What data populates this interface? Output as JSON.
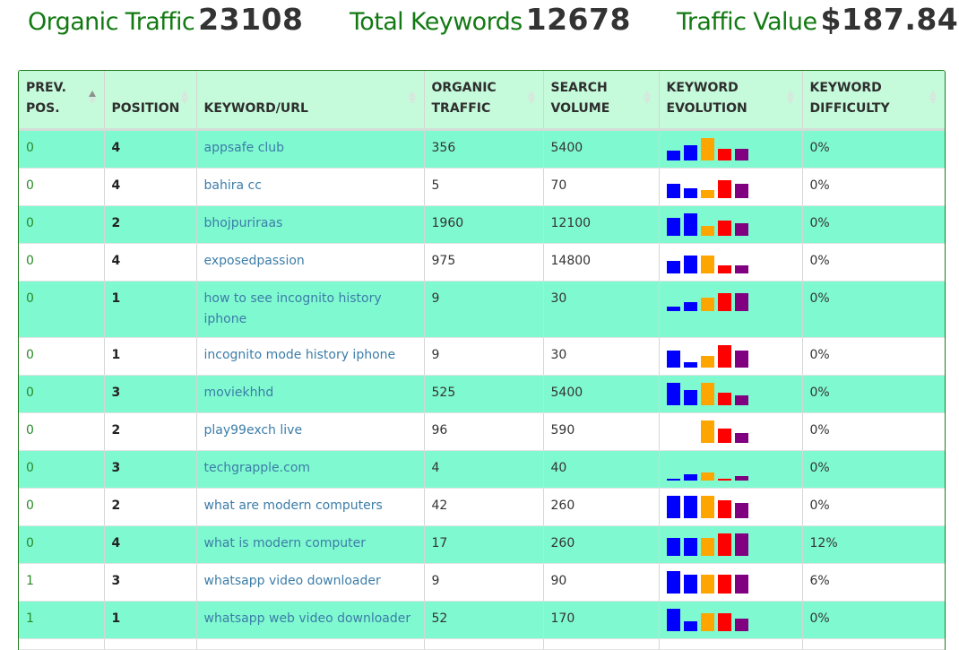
{
  "stats": {
    "organic_traffic": {
      "label": "Organic Traffic",
      "value": "23108"
    },
    "total_keywords": {
      "label": "Total Keywords",
      "value": "12678"
    },
    "traffic_value": {
      "label": "Traffic Value",
      "value": "$187.84"
    }
  },
  "colors": {
    "bar_colors": [
      "#0000ff",
      "#0000ff",
      "#ffa500",
      "#ff0000",
      "#800080"
    ],
    "stat_label": "#137a13",
    "header_bg": "#c5fadb",
    "odd_row_bg": "#7ff9d0"
  },
  "table": {
    "headers": [
      {
        "label": "PREV. POS.",
        "sort": "ascending"
      },
      {
        "label": "POSITION",
        "sort": "none"
      },
      {
        "label": "KEYWORD/URL",
        "sort": "none"
      },
      {
        "label": "ORGANIC TRAFFIC",
        "sort": "none"
      },
      {
        "label": "SEARCH VOLUME",
        "sort": "none"
      },
      {
        "label": "KEYWORD EVOLUTION",
        "sort": "none"
      },
      {
        "label": "KEYWORD DIFFICULTY",
        "sort": "none"
      }
    ],
    "rows": [
      {
        "prev": "0",
        "pos": "4",
        "keyword": "appsafe club",
        "traffic": "356",
        "volume": "5400",
        "evolution": [
          0.44,
          0.68,
          1.0,
          0.52,
          0.52
        ],
        "difficulty": "0%"
      },
      {
        "prev": "0",
        "pos": "4",
        "keyword": "bahira cc",
        "traffic": "5",
        "volume": "70",
        "evolution": [
          0.64,
          0.44,
          0.36,
          0.8,
          0.64
        ],
        "difficulty": "0%"
      },
      {
        "prev": "0",
        "pos": "2",
        "keyword": "bhojpuriraas",
        "traffic": "1960",
        "volume": "12100",
        "evolution": [
          0.8,
          1.0,
          0.44,
          0.68,
          0.56
        ],
        "difficulty": "0%"
      },
      {
        "prev": "0",
        "pos": "4",
        "keyword": "exposedpassion",
        "traffic": "975",
        "volume": "14800",
        "evolution": [
          0.56,
          0.8,
          0.8,
          0.36,
          0.36
        ],
        "difficulty": "0%"
      },
      {
        "prev": "0",
        "pos": "1",
        "keyword": "how to see incognito history iphone",
        "traffic": "9",
        "volume": "30",
        "evolution": [
          0.2,
          0.4,
          0.6,
          0.8,
          0.8
        ],
        "difficulty": "0%"
      },
      {
        "prev": "0",
        "pos": "1",
        "keyword": "incognito mode history iphone",
        "traffic": "9",
        "volume": "30",
        "evolution": [
          0.76,
          0.24,
          0.52,
          1.0,
          0.76
        ],
        "difficulty": "0%"
      },
      {
        "prev": "0",
        "pos": "3",
        "keyword": "moviekhhd",
        "traffic": "525",
        "volume": "5400",
        "evolution": [
          1.0,
          0.68,
          1.0,
          0.56,
          0.44
        ],
        "difficulty": "0%"
      },
      {
        "prev": "0",
        "pos": "2",
        "keyword": "play99exch live",
        "traffic": "96",
        "volume": "590",
        "evolution": [
          0,
          0,
          1.0,
          0.64,
          0.44
        ],
        "difficulty": "0%"
      },
      {
        "prev": "0",
        "pos": "3",
        "keyword": "techgrapple.com",
        "traffic": "4",
        "volume": "40",
        "evolution": [
          0.08,
          0.28,
          0.36,
          0.08,
          0.2
        ],
        "difficulty": "0%"
      },
      {
        "prev": "0",
        "pos": "2",
        "keyword": "what are modern computers",
        "traffic": "42",
        "volume": "260",
        "evolution": [
          1.0,
          1.0,
          1.0,
          0.8,
          0.68
        ],
        "difficulty": "0%"
      },
      {
        "prev": "0",
        "pos": "4",
        "keyword": "what is modern computer",
        "traffic": "17",
        "volume": "260",
        "evolution": [
          0.8,
          0.8,
          0.8,
          1.0,
          1.0
        ],
        "difficulty": "12%"
      },
      {
        "prev": "1",
        "pos": "3",
        "keyword": "whatsapp video downloader",
        "traffic": "9",
        "volume": "90",
        "evolution": [
          1.0,
          0.84,
          0.84,
          0.84,
          0.84
        ],
        "difficulty": "6%"
      },
      {
        "prev": "1",
        "pos": "1",
        "keyword": "whatsapp web video downloader",
        "traffic": "52",
        "volume": "170",
        "evolution": [
          1.0,
          0.44,
          0.8,
          0.8,
          0.56
        ],
        "difficulty": "0%"
      }
    ]
  }
}
